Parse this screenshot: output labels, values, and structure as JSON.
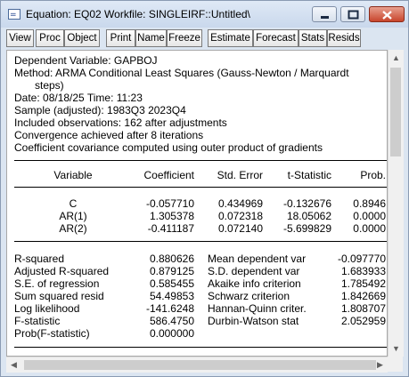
{
  "window": {
    "title": "Equation: EQ02   Workfile: SINGLEIRF::Untitled\\"
  },
  "toolbar": {
    "buttons": [
      "View",
      "Proc",
      "Object",
      "Print",
      "Name",
      "Freeze",
      "Estimate",
      "Forecast",
      "Stats",
      "Resids"
    ]
  },
  "header": {
    "dependent": "Dependent Variable: GAPBOJ",
    "method": "Method: ARMA Conditional Least Squares (Gauss-Newton / Marquardt",
    "method_cont": "steps)",
    "date": "Date: 08/18/25   Time: 11:23",
    "sample": "Sample (adjusted): 1983Q3 2023Q4",
    "observations": "Included observations: 162 after adjustments",
    "convergence": "Convergence achieved after 8 iterations",
    "covariance": "Coefficient covariance computed using outer product of gradients"
  },
  "coef_table": {
    "headers": [
      "Variable",
      "Coefficient",
      "Std. Error",
      "t-Statistic",
      "Prob."
    ],
    "rows": [
      [
        "C",
        "-0.057710",
        "0.434969",
        "-0.132676",
        "0.8946"
      ],
      [
        "AR(1)",
        "1.305378",
        "0.072318",
        "18.05062",
        "0.0000"
      ],
      [
        "AR(2)",
        "-0.411187",
        "0.072140",
        "-5.699829",
        "0.0000"
      ]
    ]
  },
  "stats_table": {
    "rows": [
      [
        "R-squared",
        "0.880626",
        "Mean dependent var",
        "-0.097770"
      ],
      [
        "Adjusted R-squared",
        "0.879125",
        "S.D. dependent var",
        "1.683933"
      ],
      [
        "S.E. of regression",
        "0.585455",
        "Akaike info criterion",
        "1.785492"
      ],
      [
        "Sum squared resid",
        "54.49853",
        "Schwarz criterion",
        "1.842669"
      ],
      [
        "Log likelihood",
        "-141.6248",
        "Hannan-Quinn criter.",
        "1.808707"
      ],
      [
        "F-statistic",
        "586.4750",
        "Durbin-Watson stat",
        "2.052959"
      ],
      [
        "Prob(F-statistic)",
        "0.000000",
        "",
        ""
      ]
    ]
  }
}
